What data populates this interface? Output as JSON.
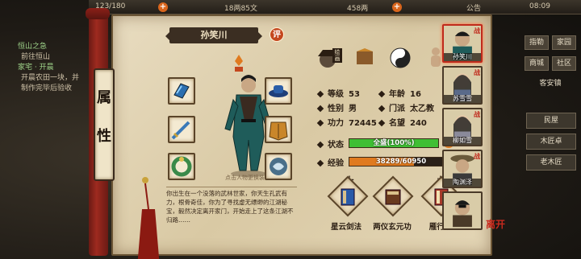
{
  "topbar": {
    "stamina": "123/180",
    "bank": "18两85文",
    "silver": "458两",
    "notice": "公告",
    "time": "08:09"
  },
  "quest": {
    "lines": [
      "恒山之急",
      "前往恒山",
      "家宅 · 开晨",
      "开晨农田一块，并",
      "制作完毕后验收"
    ]
  },
  "right_menu": {
    "btn1": "指勒",
    "btn2": "家园",
    "btn3": "商城",
    "btn4": "社区",
    "btn5": "客安镇",
    "sub1": "民屋",
    "sub2": "木匠卓",
    "sub3": "老木匠"
  },
  "sidebar_tab": {
    "char1": "属",
    "char2": "性"
  },
  "character": {
    "name": "孙笑川",
    "rate_label": "评",
    "label_badge": "绘画",
    "figure_hint": "点击人物更换装饰",
    "bio": "你出生在一个没落的武林世家，你天生孔武有力，根骨奇佳，你为了寻找虚无缥缈的江湖秘宝，毅然决定离开家门，开始走上了这条江湖不归路……"
  },
  "stats": {
    "level_label": "等级",
    "level": "53",
    "age_label": "年龄",
    "age": "16",
    "gender_label": "性别",
    "gender": "男",
    "sect_label": "门派",
    "sect": "太乙教",
    "power_label": "功力",
    "power": "72445",
    "fame_label": "名望",
    "fame": "240",
    "status_label": "状态",
    "status_text": "全盛(100%)",
    "status_ratio": 1.0,
    "exp_label": "经验",
    "exp_text": "38289/60950",
    "exp_ratio": 0.628
  },
  "skills": [
    {
      "name": "星云剑法",
      "num": "十"
    },
    {
      "name": "两仪玄元功",
      "num": "一"
    },
    {
      "name": "雁行功",
      "num": "九"
    }
  ],
  "roster": [
    {
      "name": "孙笑川",
      "flag": "战"
    },
    {
      "name": "苏雪雪",
      "flag": "战"
    },
    {
      "name": "柳如雪",
      "flag": "战"
    },
    {
      "name": "陶渊泽",
      "flag": "战"
    },
    {
      "name": "",
      "flag": ""
    }
  ],
  "seal": "离开",
  "colors": {
    "accent": "#c4471e",
    "status_fill": "#3fbf34",
    "exp_fill": "#e07a1f"
  }
}
